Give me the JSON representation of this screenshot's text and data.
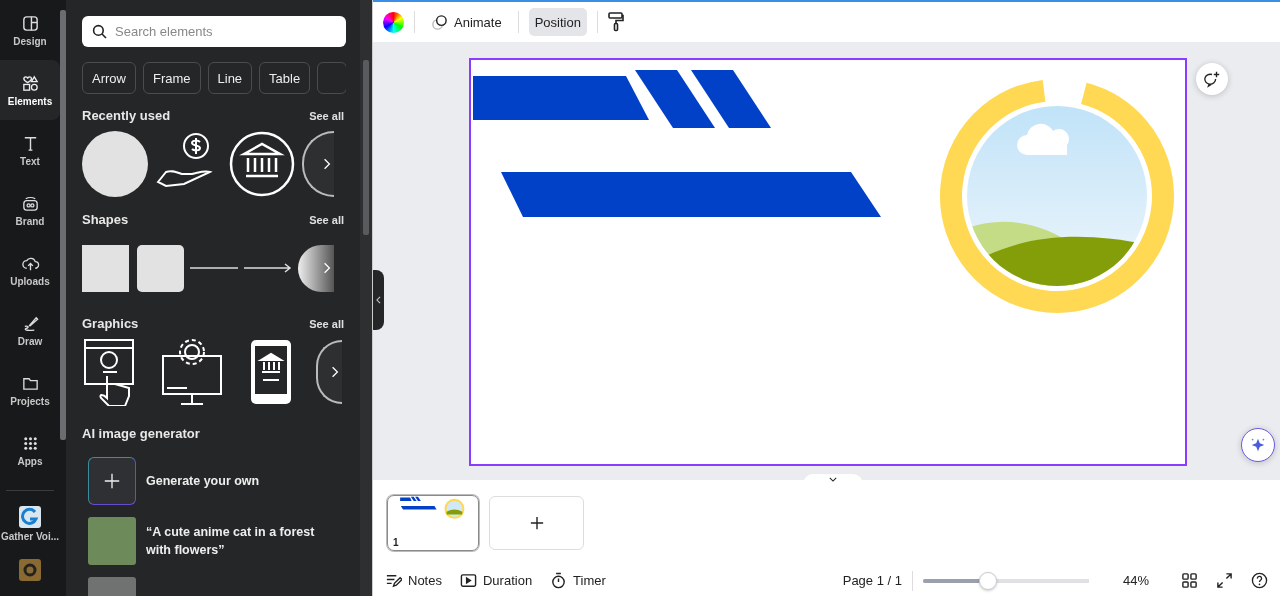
{
  "nav": {
    "items": [
      {
        "label": "Design",
        "kind": "design",
        "selected": false
      },
      {
        "label": "Elements",
        "kind": "elements",
        "selected": true
      },
      {
        "label": "Text",
        "kind": "text",
        "selected": false
      },
      {
        "label": "Brand",
        "kind": "brand",
        "selected": false
      },
      {
        "label": "Uploads",
        "kind": "uploads",
        "selected": false
      },
      {
        "label": "Draw",
        "kind": "draw",
        "selected": false
      },
      {
        "label": "Projects",
        "kind": "projects",
        "selected": false
      },
      {
        "label": "Apps",
        "kind": "apps",
        "selected": false
      }
    ],
    "apps": [
      {
        "label": "Gather Voi..."
      }
    ]
  },
  "panel": {
    "search": {
      "placeholder": "Search elements"
    },
    "chips": [
      "Arrow",
      "Frame",
      "Line",
      "Table"
    ],
    "sections": [
      {
        "title": "Recently used",
        "link": "See all",
        "kind": "recent"
      },
      {
        "title": "Shapes",
        "link": "See all",
        "kind": "shapes"
      },
      {
        "title": "Graphics",
        "link": "See all",
        "kind": "graphics"
      }
    ],
    "ai": {
      "title": "AI image generator",
      "items": [
        {
          "kind": "generate",
          "text": "Generate your own"
        },
        {
          "kind": "prompt",
          "text": "“A cute anime cat in a forest with flowers”"
        }
      ]
    }
  },
  "toolbar": {
    "tools": [
      {
        "label": "Animate",
        "kind": "animate",
        "selected": false
      },
      {
        "label": "Position",
        "kind": "position",
        "selected": true
      }
    ]
  },
  "pages": [
    {
      "number": "1",
      "selected": true
    }
  ],
  "footer": {
    "left": [
      {
        "label": "Notes",
        "kind": "notes"
      },
      {
        "label": "Duration",
        "kind": "duration"
      },
      {
        "label": "Timer",
        "kind": "timer"
      }
    ],
    "page": "Page 1 / 1",
    "zoom": {
      "level": 0.39
    },
    "zoom_reading": "44%"
  }
}
